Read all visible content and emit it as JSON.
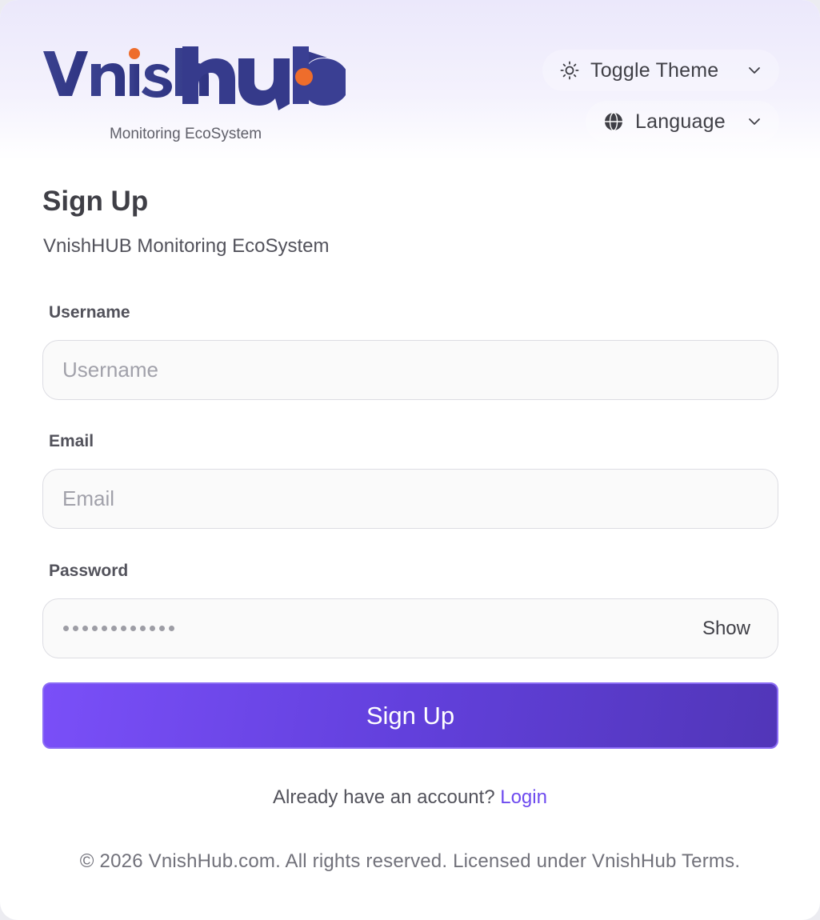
{
  "brand": {
    "logo_text": "VnishHub",
    "tagline": "Monitoring EcoSystem",
    "colors": {
      "primary": "#3b3f8f",
      "dot": "#ee6d2c"
    }
  },
  "header": {
    "theme_toggle": {
      "label": "Toggle Theme",
      "icon": "sun-icon"
    },
    "language": {
      "label": "Language",
      "icon": "globe-icon"
    }
  },
  "form": {
    "title": "Sign Up",
    "subtitle": "VnishHUB Monitoring EcoSystem",
    "username": {
      "label": "Username",
      "placeholder": "Username",
      "value": ""
    },
    "email": {
      "label": "Email",
      "placeholder": "Email",
      "value": ""
    },
    "password": {
      "label": "Password",
      "masked_length": 12,
      "toggle_label": "Show"
    },
    "submit_label": "Sign Up",
    "accent": "#7a4ff8"
  },
  "login_prompt": {
    "text": "Already have an account?",
    "link": "Login"
  },
  "footer": {
    "text": "© 2026 VnishHub.com. All rights reserved. Licensed under VnishHub Terms."
  }
}
